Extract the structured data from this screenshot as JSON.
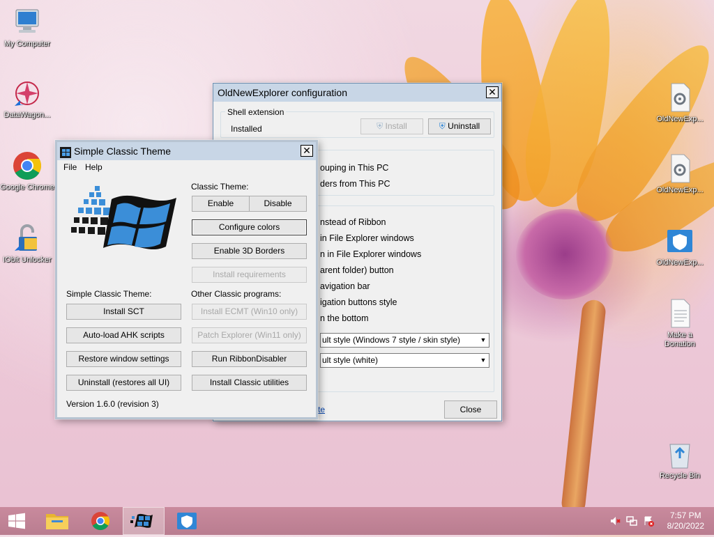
{
  "desktop": {
    "left_icons": [
      "My Computer",
      "DataWagon...",
      "Google Chrome",
      "IObit Unlocker"
    ],
    "right_icons": [
      "OldNewExp...",
      "OldNewExp...",
      "OldNewExp...",
      "Make a Donation",
      "Recycle Bin"
    ]
  },
  "one_window": {
    "title": "OldNewExplorer configuration",
    "shell_group_label": "Shell extension",
    "status_text": "Installed",
    "install_label": "Install",
    "uninstall_label": "Uninstall",
    "behavior_items": [
      "ouping in This PC",
      "ders from This PC"
    ],
    "appearance_items": [
      "nstead of Ribbon",
      "in File Explorer windows",
      "n in File Explorer windows",
      "arent folder) button",
      "avigation bar",
      "igation buttons style",
      "n the bottom"
    ],
    "combo1_value": "ult style (Windows 7 style / skin style)",
    "combo2_value": "ult style (white)",
    "link_text": "te",
    "close_label": "Close"
  },
  "sct_window": {
    "title": "Simple Classic Theme",
    "menu": [
      "File",
      "Help"
    ],
    "classic_theme_label": "Classic Theme:",
    "enable_label": "Enable",
    "disable_label": "Disable",
    "configure_colors_label": "Configure colors",
    "enable_3d_label": "Enable 3D Borders",
    "install_req_label": "Install requirements",
    "sct_label": "Simple Classic Theme:",
    "other_label": "Other Classic programs:",
    "install_sct_label": "Install SCT",
    "install_ecmt_label": "Install ECMT (Win10 only)",
    "autoload_label": "Auto-load AHK scripts",
    "patch_label": "Patch Explorer (Win11 only)",
    "restore_label": "Restore window settings",
    "ribbon_label": "Run RibbonDisabler",
    "uninstall_label": "Uninstall (restores all UI)",
    "classic_util_label": "Install Classic utilities",
    "version_text": "Version 1.6.0 (revision 3)"
  },
  "taskbar": {
    "time": "7:57 PM",
    "date": "8/20/2022"
  },
  "colors": {
    "titlebar": "#c8d6e6",
    "shield_blue": "#2f86d6",
    "taskbar": "#c98a9d"
  }
}
